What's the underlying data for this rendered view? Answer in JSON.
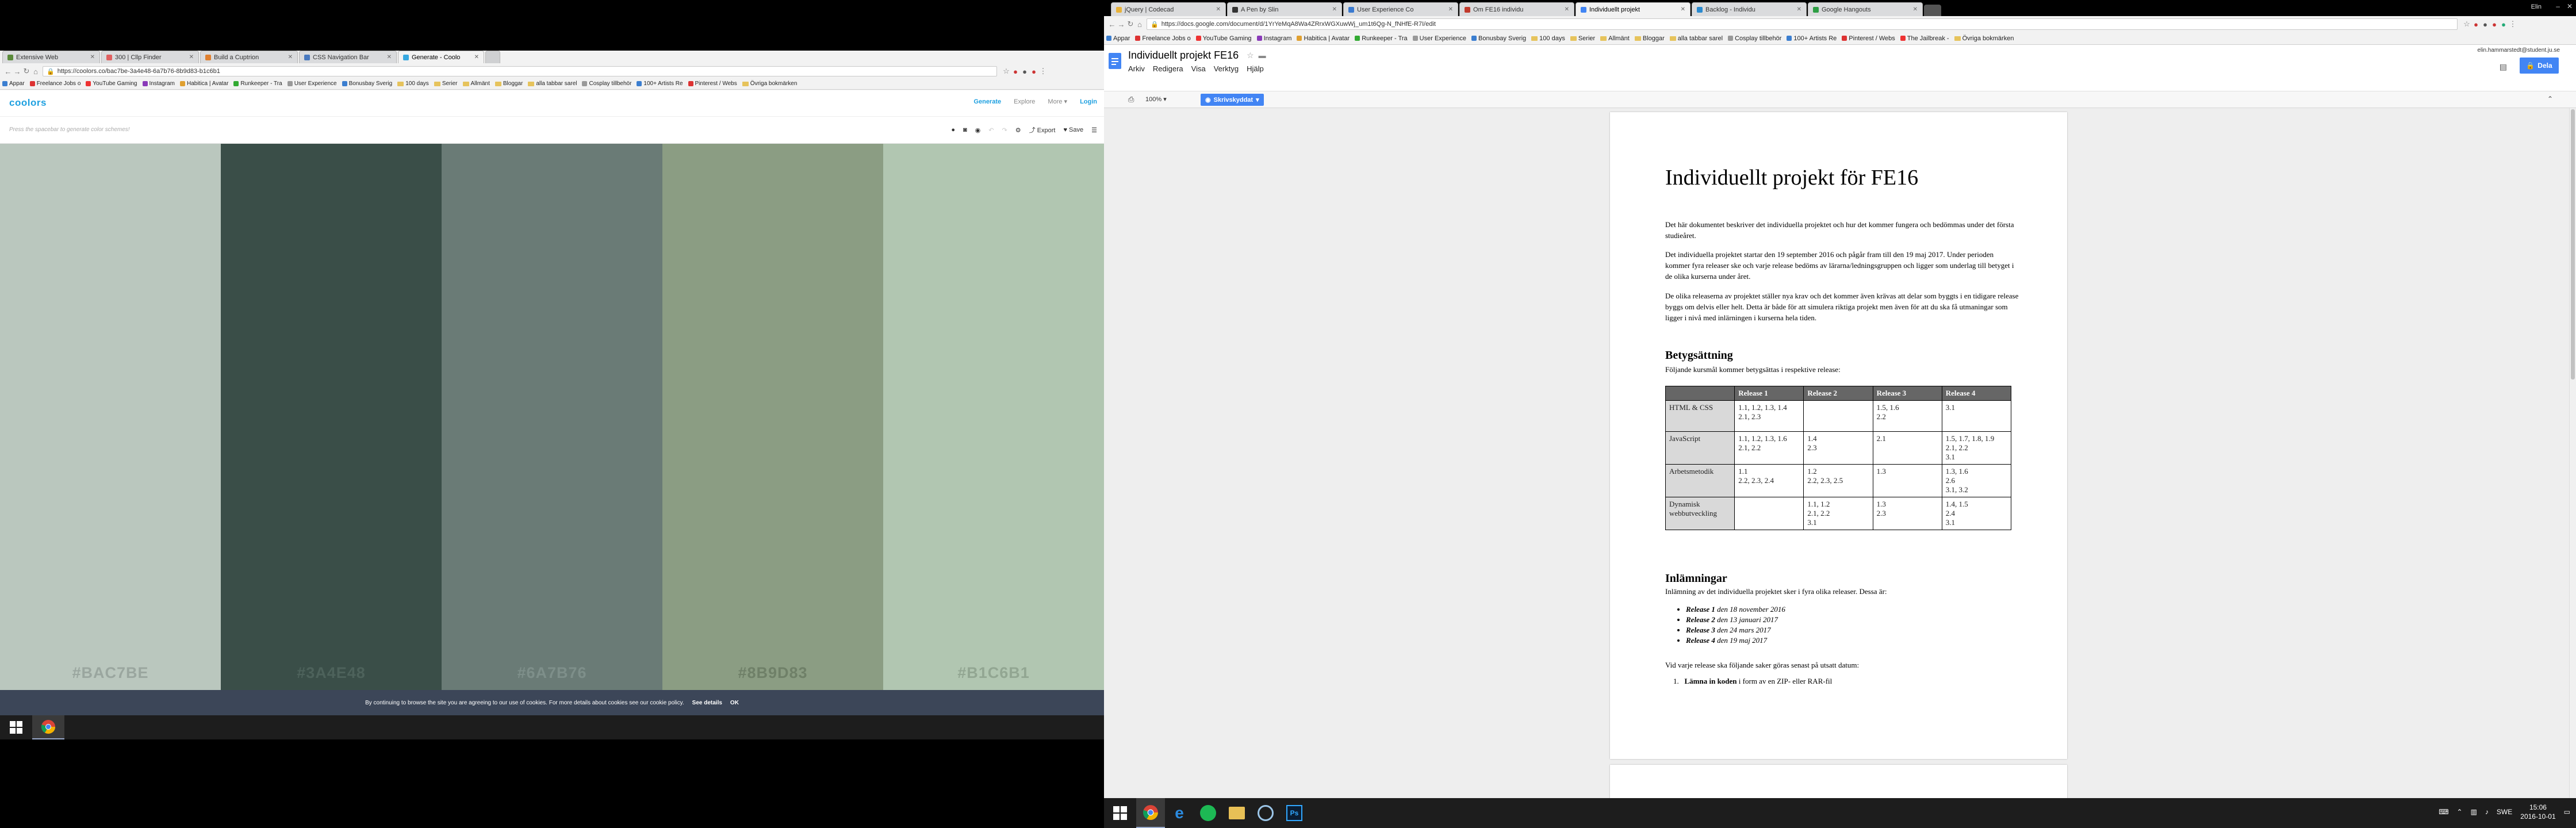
{
  "left_browser": {
    "tabs": [
      {
        "label": "Extensive Web",
        "color": "#5a8a3a"
      },
      {
        "label": "300 | Cllp Finder",
        "color": "#e06060"
      },
      {
        "label": "Build a Cuptrion",
        "color": "#e08030"
      },
      {
        "label": "CSS Navigation Bar",
        "color": "#4a7ac0"
      },
      {
        "label": "Generate - Coolo",
        "color": "#37a8e0"
      }
    ],
    "url": "https://coolors.co/bac7be-3a4e48-6a7b76-8b9d83-b1c6b1",
    "bookmarks": [
      "Appar",
      "Freelance Jobs o",
      "YouTube Gaming",
      "Instagram",
      "Habitica | Avatar",
      "Runkeeper - Tra",
      "User Experience",
      "Bonusbay Sverig",
      "100 days",
      "Serier",
      "Allmänt",
      "Bloggar",
      "alla tabbar sarel",
      "Cosplay tillbehör",
      "100+ Artists Re",
      "Pinterest / Webs",
      "Övriga bokmärken"
    ]
  },
  "coolors": {
    "logo": "coolors",
    "nav": [
      "Generate",
      "Explore",
      "More",
      "Login"
    ],
    "hint": "Press the spacebar to generate color schemes!",
    "export_label": "Export",
    "save_label": "Save",
    "colors": [
      {
        "hex": "#BAC7BE",
        "label_color": "#9aa69f"
      },
      {
        "hex": "#3A4E48",
        "label_color": "#4d625b"
      },
      {
        "hex": "#6A7B76",
        "label_color": "#7e8f8a"
      },
      {
        "hex": "#8B9D83",
        "label_color": "#6f8068"
      },
      {
        "hex": "#B1C6B1",
        "label_color": "#92a692"
      }
    ],
    "cookie_text": "By continuing to browse the site you are agreeing to our use of cookies. For more details about cookies see our cookie policy.",
    "cookie_details": "See details",
    "cookie_ok": "OK"
  },
  "left_taskbar": {
    "apps": [
      "windows-start",
      "chrome"
    ]
  },
  "right_browser": {
    "tabs": [
      {
        "label": "jQuery | Codecad",
        "color": "#e8b23a"
      },
      {
        "label": "A Pen by Slin",
        "color": "#333333"
      },
      {
        "label": "User Experience Co",
        "color": "#3a7ad0"
      },
      {
        "label": "Om FE16 individu",
        "color": "#c0392b"
      },
      {
        "label": "Individuellt projekt",
        "color": "#4285f4"
      },
      {
        "label": "Backlog - Individu",
        "color": "#2a8ad0"
      },
      {
        "label": "Google Hangouts",
        "color": "#2e9e44"
      }
    ],
    "window_user": "Elin",
    "url": "https://docs.google.com/document/d/1YrYeMqA8Wa4ZRrxWGXuwWj_um1t6Qg-N_fNHfE-R7I/edit",
    "bookmarks": [
      "Appar",
      "Freelance Jobs o",
      "YouTube Gaming",
      "Instagram",
      "Habitica | Avatar",
      "Runkeeper - Tra",
      "User Experience",
      "Bonusbay Sverig",
      "100 days",
      "Serier",
      "Allmänt",
      "Bloggar",
      "alla tabbar sarel",
      "Cosplay tillbehör",
      "100+ Artists Re",
      "Pinterest / Webs",
      "The Jailbreak -",
      "Övriga bokmärken"
    ]
  },
  "docs": {
    "title": "Individuellt projekt FE16",
    "user_email": "elin.hammarstedt@student.ju.se",
    "share_label": "Dela",
    "menus": [
      "Arkiv",
      "Redigera",
      "Visa",
      "Verktyg",
      "Hjälp"
    ],
    "zoom": "100%",
    "mode": "Skrivskyddat",
    "heading": "Individuellt projekt för FE16",
    "p1": "Det här dokumentet beskriver det individuella projektet och hur det kommer fungera och bedömmas under det första studieåret.",
    "p2": "Det individuella projektet startar den 19 september 2016 och pågår fram till den 19 maj 2017. Under perioden kommer fyra releaser ske och varje release bedöms av lärarna/ledningsgruppen och ligger som underlag till betyget i de olika kurserna under året.",
    "p3": "De olika releaserna av projektet ställer nya krav och det kommer även krävas att delar som byggts i en tidigare release byggs om delvis eller helt. Detta är både för att simulera riktiga projekt men även för att du ska få utmaningar som ligger i nivå med inlärningen i kurserna hela tiden.",
    "h_grading": "Betygsättning",
    "p_grading": "Följande kursmål kommer betygsättas i respektive release:",
    "table_headers": [
      "",
      "Release 1",
      "Release 2",
      "Release 3",
      "Release 4"
    ],
    "table_rows": [
      [
        "HTML & CSS",
        "1.1, 1.2, 1.3, 1.4\n2.1, 2.3",
        "",
        "1.5, 1.6\n2.2",
        "3.1"
      ],
      [
        "JavaScript",
        "1.1, 1.2, 1.3, 1.6\n2.1, 2.2",
        "1.4\n2.3",
        "2.1",
        "1.5, 1.7, 1.8, 1.9\n2.1, 2.2\n3.1"
      ],
      [
        "Arbetsmetodik",
        "1.1\n2.2, 2.3, 2.4",
        "1.2\n2.2, 2.3, 2.5",
        "1.3",
        "1.3, 1.6\n2.6\n3.1, 3.2"
      ],
      [
        "Dynamisk webbutveckling",
        "",
        "1.1, 1.2\n2.1, 2.2\n3.1",
        "1.3\n2.3",
        "1.4, 1.5\n2.4\n3.1"
      ]
    ],
    "h_submissions": "Inlämningar",
    "p_submissions": "Inlämning av det individuella projektet sker i fyra olika releaser. Dessa är:",
    "releases": [
      {
        "name": "Release 1",
        "date": "den 18 november 2016"
      },
      {
        "name": "Release 2",
        "date": "den 13 januari 2017"
      },
      {
        "name": "Release 3",
        "date": "den 24 mars 2017"
      },
      {
        "name": "Release 4",
        "date": "den 19 maj 2017"
      }
    ],
    "p_each": "Vid varje release ska följande saker göras senast på utsatt datum:",
    "step1_bold": "Lämna in koden",
    "step1_rest": " i form av en ZIP- eller RAR-fil"
  },
  "right_taskbar": {
    "apps": [
      "windows-start",
      "chrome",
      "internet-explorer",
      "spotify",
      "file-explorer",
      "web-tool",
      "photoshop"
    ],
    "lang": "SWE",
    "time": "15:06",
    "date": "2016-10-01"
  }
}
